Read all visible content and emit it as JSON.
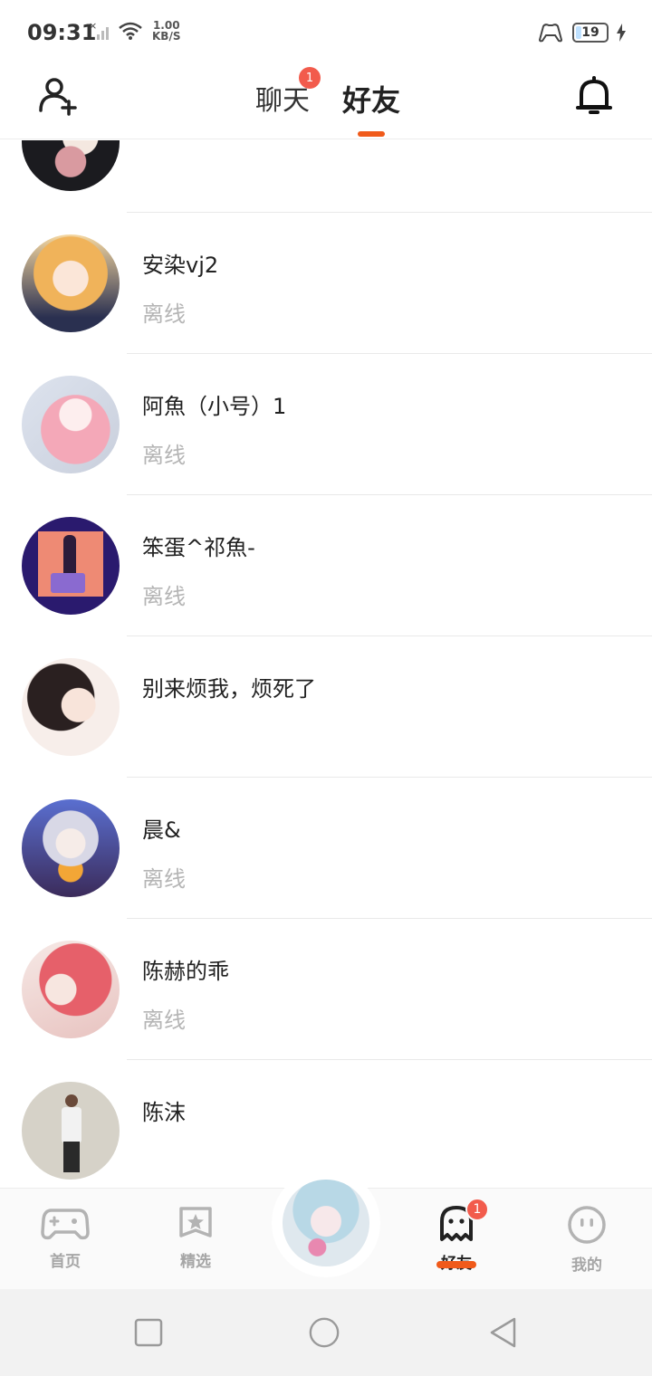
{
  "status_bar": {
    "time": "09:31",
    "net_speed_value": "1.00",
    "net_speed_unit": "KB/S",
    "battery_level": "19"
  },
  "header": {
    "tabs": [
      {
        "label": "聊天",
        "badge": "1"
      },
      {
        "label": "好友"
      }
    ]
  },
  "friends": [
    {
      "name": "",
      "status": ""
    },
    {
      "name": "安染vj2",
      "status": "离线"
    },
    {
      "name": "阿魚（小号）1",
      "status": "离线"
    },
    {
      "name": "笨蛋^祁魚-",
      "status": "离线"
    },
    {
      "name": "别来烦我，烦死了",
      "status": ""
    },
    {
      "name": "晨&",
      "status": "离线"
    },
    {
      "name": "陈赫的乖",
      "status": "离线"
    },
    {
      "name": "陈沫",
      "status": ""
    }
  ],
  "bottom_nav": {
    "items": [
      {
        "label": "首页"
      },
      {
        "label": "精选"
      },
      {
        "label": "好友",
        "badge": "1"
      },
      {
        "label": "我的"
      }
    ]
  },
  "colors": {
    "accent": "#f05a1a",
    "badge": "#f25b4c",
    "offline_text": "#b5b5b5"
  }
}
